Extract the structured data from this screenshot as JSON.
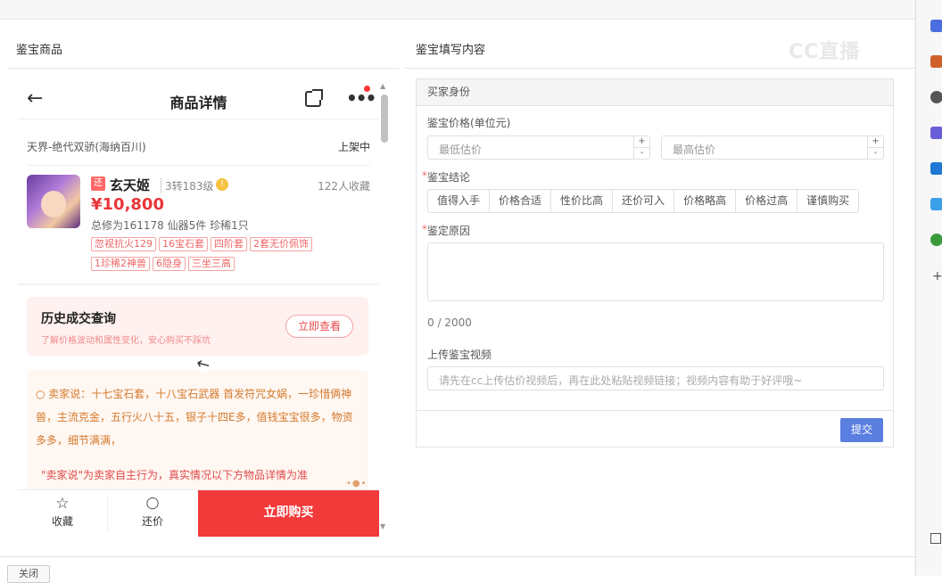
{
  "left_header": "鉴宝商品",
  "right_header": "鉴宝填写内容",
  "watermark": "CC直播",
  "phone": {
    "nav_title": "商品详情",
    "server": "天界-绝代双骄(海纳百川)",
    "status": "上架中",
    "tag_char": "还",
    "name": "玄天姬",
    "level": "3转183级",
    "fav_count": "122人收藏",
    "price": "¥10,800",
    "attrs": "总修为161178  仙器5件  珍稀1只",
    "chips_row1": [
      "忽视抗火129",
      "16宝石套",
      "四阶套",
      "2套无价佩饰"
    ],
    "chips_row2": [
      "1珍稀2神兽",
      "6隐身",
      "三坐三高"
    ],
    "history_title": "历史成交查询",
    "history_sub": "了解价格波动和属性变化，安心购买不踩坑",
    "history_btn": "立即查看",
    "seller_text": "卖家说：十七宝石套，十八宝石武器 首发符咒女娲，一珍惜俩神兽，主流克金，五行火八十五，银子十四E多，值钱宝宝很多，物资多多，细节满满，",
    "seller_note": "\"卖家说\"为卖家自主行为，真实情况以下方物品详情为准",
    "bottom": {
      "fav_label": "收藏",
      "bargain_label": "还价",
      "buy_label": "立即购买"
    }
  },
  "form": {
    "section": "买家身份",
    "price_label": "鉴宝价格(单位元)",
    "min_placeholder": "最低估价",
    "max_placeholder": "最高估价",
    "verdict_label": "鉴宝结论",
    "verdicts": [
      "值得入手",
      "价格合适",
      "性价比高",
      "还价可入",
      "价格略高",
      "价格过高",
      "谨慎购买"
    ],
    "reason_label": "鉴定原因",
    "counter": "0 / 2000",
    "video_label": "上传鉴宝视频",
    "video_placeholder": "请先在cc上传估价视频后，再在此处粘贴视频链接；视频内容有助于好评哦~",
    "submit": "提交"
  },
  "footer": {
    "close_label": "关闭"
  },
  "colors": {
    "accent_red": "#f33a3a",
    "price_red": "#e8363a",
    "submit_blue": "#5a7fe0",
    "seller_orange": "#d47a2c"
  }
}
